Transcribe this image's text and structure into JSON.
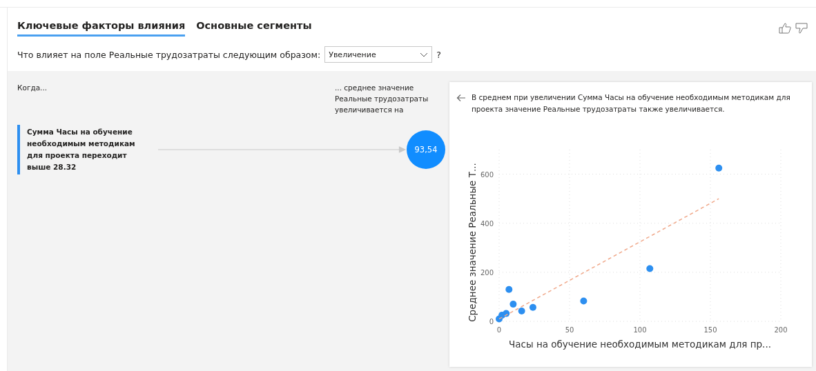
{
  "tabs": [
    {
      "label": "Ключевые факторы влияния",
      "selected": true
    },
    {
      "label": "Основные сегменты",
      "selected": false
    }
  ],
  "question": {
    "label": "Что влияет на поле Реальные трудозатраты следующим образом:",
    "dropdown_value": "Увеличение",
    "help": "?"
  },
  "influencers": {
    "when_header": "Когда...",
    "effect_header": "... среднее значение Реальные трудозатраты увеличивается на",
    "items": [
      {
        "text": "Сумма Часы на обучение необходимым методикам для проекта переходит выше 28.32",
        "value": "93,54",
        "selected": true
      }
    ]
  },
  "detail": {
    "description": "В среднем при увеличении Сумма Часы на обучение необходимым методикам для проекта значение Реальные трудозатраты также увеличивается.",
    "chart_data": {
      "type": "scatter",
      "xlabel": "Часы на обучение необходимым методикам для пр...",
      "ylabel": "Среднее значение Реальные Т...",
      "x": [
        0,
        2,
        5,
        7,
        10,
        16,
        24,
        60,
        107,
        156
      ],
      "series": [
        {
          "type": "scatter",
          "color": "#2d8ff0",
          "values": [
            10,
            25,
            32,
            130,
            70,
            42,
            57,
            83,
            215,
            625
          ]
        },
        {
          "type": "line",
          "line_style": "dashed",
          "color": "#f0a88a",
          "values": [
            10,
            null,
            null,
            null,
            null,
            null,
            null,
            null,
            null,
            500
          ]
        }
      ],
      "grid": true,
      "xlim": [
        0,
        200
      ],
      "ylim": [
        0,
        700
      ],
      "xticks": [
        0,
        50,
        100,
        150,
        200
      ],
      "yticks": [
        0,
        200,
        400,
        600
      ]
    }
  }
}
